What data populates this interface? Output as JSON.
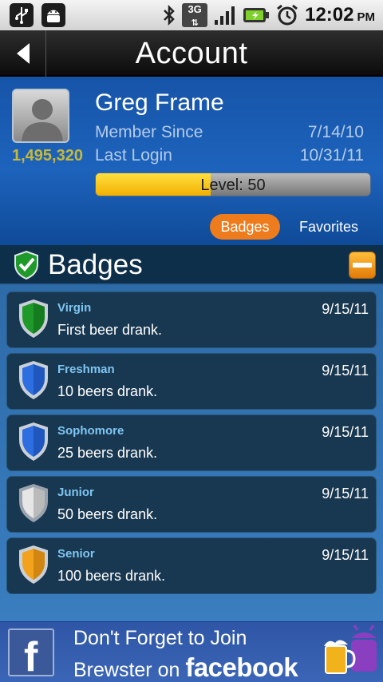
{
  "status_bar": {
    "time": "12:02",
    "ampm": "PM",
    "network": "3G",
    "icons": [
      "usb-icon",
      "android-debug-icon",
      "bluetooth-icon",
      "signal-icon",
      "battery-charging-icon",
      "alarm-icon"
    ]
  },
  "header": {
    "title": "Account"
  },
  "profile": {
    "name": "Greg Frame",
    "points": "1,495,320",
    "member_since_label": "Member Since",
    "member_since_value": "7/14/10",
    "last_login_label": "Last Login",
    "last_login_value": "10/31/11",
    "level_text": "Level: 50",
    "level_progress": 0.42
  },
  "tabs": {
    "badges": "Badges",
    "favorites": "Favorites"
  },
  "badges_section": {
    "title": "Badges"
  },
  "badges": [
    {
      "title": "Virgin",
      "desc": "First beer drank.",
      "date": "9/15/11",
      "color": "green"
    },
    {
      "title": "Freshman",
      "desc": "10 beers drank.",
      "date": "9/15/11",
      "color": "blue"
    },
    {
      "title": "Sophomore",
      "desc": "25 beers drank.",
      "date": "9/15/11",
      "color": "blue"
    },
    {
      "title": "Junior",
      "desc": "50 beers drank.",
      "date": "9/15/11",
      "color": "silver"
    },
    {
      "title": "Senior",
      "desc": "100 beers drank.",
      "date": "9/15/11",
      "color": "gold"
    }
  ],
  "ad": {
    "line1": "Don't Forget to Join",
    "line2_prefix": "Brewster on",
    "line2_brand": "facebook",
    "logo_letter": "f"
  },
  "colors": {
    "green": [
      "#8ee28a",
      "#1f9a2a",
      "#0d5e15"
    ],
    "blue": [
      "#9fc8ff",
      "#2d6ee0",
      "#123f9c"
    ],
    "silver": [
      "#ffffff",
      "#d3d3d3",
      "#8d8d8d"
    ],
    "gold": [
      "#ffe28a",
      "#f2a21c",
      "#b06a05"
    ]
  }
}
